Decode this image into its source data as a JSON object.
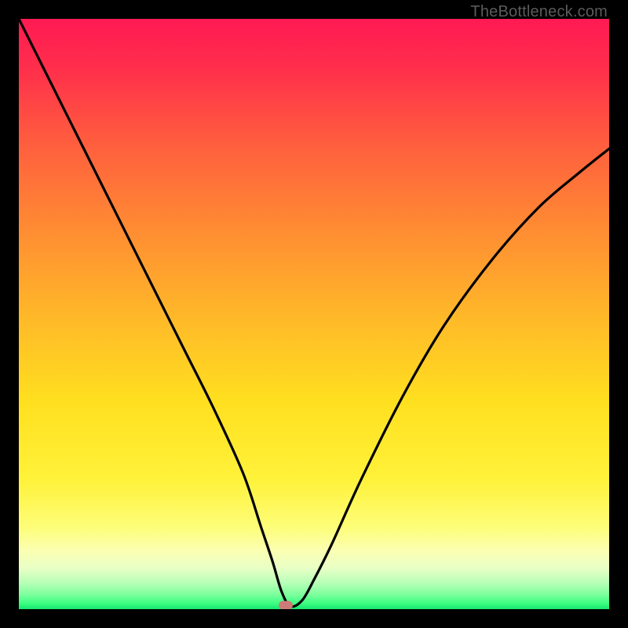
{
  "watermark": "TheBottleneck.com",
  "chart_data": {
    "type": "line",
    "title": "",
    "xlabel": "",
    "ylabel": "",
    "xlim": [
      0,
      100
    ],
    "ylim": [
      0,
      100
    ],
    "grid": false,
    "series": [
      {
        "name": "bottleneck-curve",
        "x": [
          0,
          3,
          8,
          13,
          18,
          23,
          28,
          33,
          38,
          41,
          43,
          44.5,
          46,
          48,
          50,
          53,
          58,
          65,
          72,
          80,
          88,
          95,
          100
        ],
        "values": [
          100,
          94,
          84,
          74,
          64,
          54,
          44,
          34,
          23,
          14,
          8,
          3,
          0.5,
          1.5,
          5,
          11,
          22,
          36,
          48,
          59,
          68,
          74,
          78
        ]
      }
    ],
    "marker": {
      "x": 45.2,
      "y": 0.6,
      "color": "#cc7b78"
    },
    "background_gradient_stops": [
      {
        "pos": 0.0,
        "color": "#ff1a53"
      },
      {
        "pos": 0.08,
        "color": "#ff2d4c"
      },
      {
        "pos": 0.2,
        "color": "#ff5a3f"
      },
      {
        "pos": 0.35,
        "color": "#ff8a33"
      },
      {
        "pos": 0.5,
        "color": "#ffb729"
      },
      {
        "pos": 0.65,
        "color": "#ffe01f"
      },
      {
        "pos": 0.78,
        "color": "#fff23a"
      },
      {
        "pos": 0.86,
        "color": "#fdfd77"
      },
      {
        "pos": 0.9,
        "color": "#fbffb0"
      },
      {
        "pos": 0.93,
        "color": "#e9ffc6"
      },
      {
        "pos": 0.955,
        "color": "#b8ffb8"
      },
      {
        "pos": 0.975,
        "color": "#7dff9d"
      },
      {
        "pos": 0.99,
        "color": "#3dff82"
      },
      {
        "pos": 1.0,
        "color": "#16e66e"
      }
    ]
  }
}
